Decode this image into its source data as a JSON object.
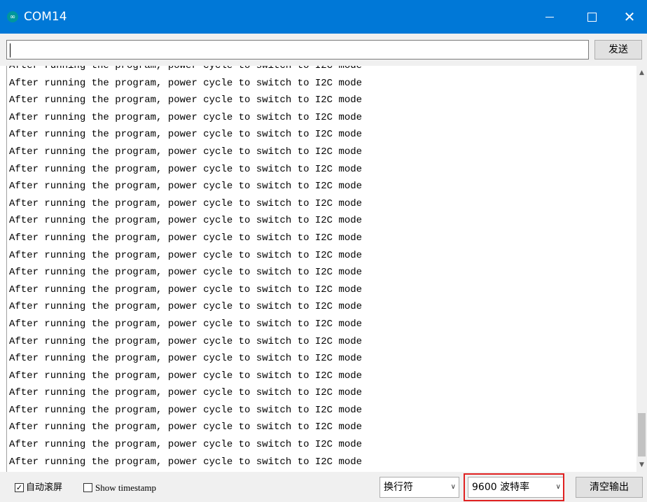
{
  "window": {
    "title": "COM14",
    "controls": {
      "minimize_icon": "minimize-icon",
      "maximize_icon": "maximize-icon",
      "close_icon": "close-icon",
      "close_glyph": "✕"
    }
  },
  "send_row": {
    "input_value": "",
    "send_label": "发送"
  },
  "output": {
    "lines": [
      "After running the program, power cycle to switch to I2C mode",
      "After running the program, power cycle to switch to I2C mode",
      "After running the program, power cycle to switch to I2C mode",
      "After running the program, power cycle to switch to I2C mode",
      "After running the program, power cycle to switch to I2C mode",
      "After running the program, power cycle to switch to I2C mode",
      "After running the program, power cycle to switch to I2C mode",
      "After running the program, power cycle to switch to I2C mode",
      "After running the program, power cycle to switch to I2C mode",
      "After running the program, power cycle to switch to I2C mode",
      "After running the program, power cycle to switch to I2C mode",
      "After running the program, power cycle to switch to I2C mode",
      "After running the program, power cycle to switch to I2C mode",
      "After running the program, power cycle to switch to I2C mode",
      "After running the program, power cycle to switch to I2C mode",
      "After running the program, power cycle to switch to I2C mode",
      "After running the program, power cycle to switch to I2C mode",
      "After running the program, power cycle to switch to I2C mode",
      "After running the program, power cycle to switch to I2C mode",
      "After running the program, power cycle to switch to I2C mode",
      "After running the program, power cycle to switch to I2C mode",
      "After running the program, power cycle to switch to I2C mode",
      "After running the program, power cycle to switch to I2C mode",
      "After running the program, power cycle to switch to I2C mode",
      "Aft"
    ]
  },
  "bottom_bar": {
    "autoscroll": {
      "label": "自动滚屏",
      "checked": true,
      "check_glyph": "✓"
    },
    "timestamp": {
      "label": "Show timestamp",
      "checked": false
    },
    "line_ending": {
      "selected": "换行符"
    },
    "baud_rate": {
      "selected": "9600 波特率"
    },
    "clear_label": "清空输出"
  },
  "colors": {
    "title_bar": "#0078d7",
    "highlight": "#e02020"
  }
}
